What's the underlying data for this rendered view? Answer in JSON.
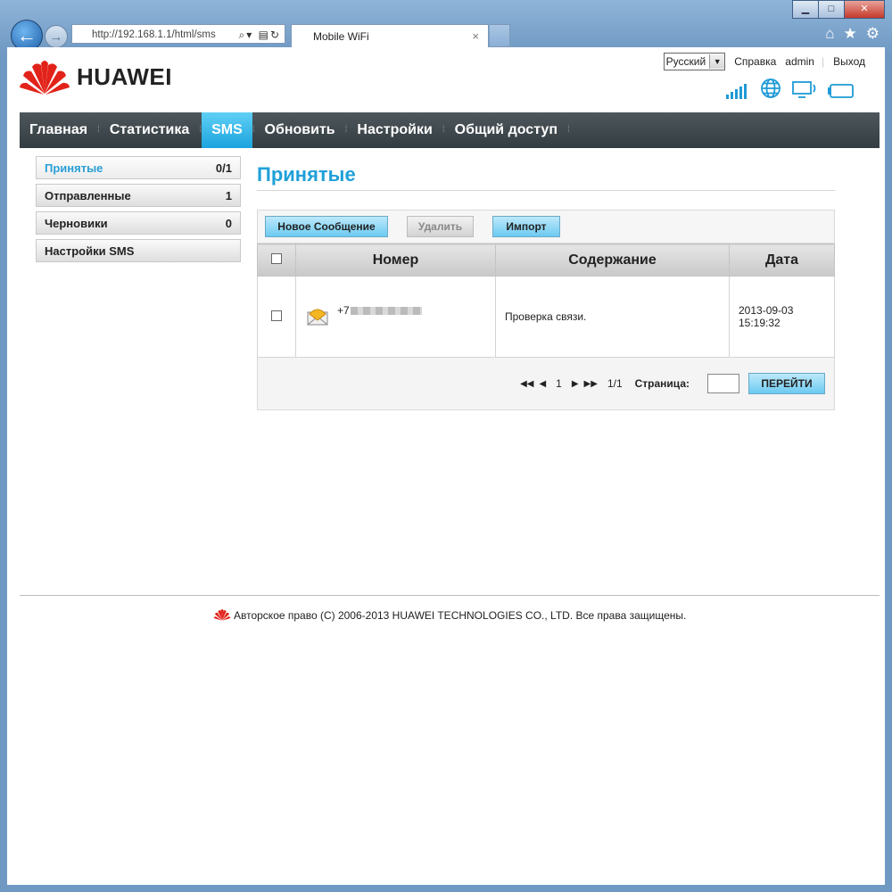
{
  "browser": {
    "address": "http://192.168.1.1/html/sms",
    "tab_title": "Mobile WiFi",
    "tab_close": "×",
    "window_controls": [
      "minimize-icon",
      "maximize-icon",
      "close-icon"
    ],
    "toolbar_icons": [
      "home-icon",
      "favorites-star-icon",
      "gear-icon"
    ]
  },
  "header": {
    "logo_text": "HUAWEI",
    "language": "Русский",
    "help": "Справка",
    "user": "admin",
    "logout": "Выход",
    "status_icons": [
      "signal-strength-icon",
      "internet-globe-icon",
      "connected-device-icon",
      "battery-icon"
    ]
  },
  "nav": {
    "items": [
      "Главная",
      "Статистика",
      "SMS",
      "Обновить",
      "Настройки",
      "Общий доступ"
    ],
    "active": "SMS"
  },
  "sidebar": {
    "items": [
      {
        "label": "Принятые",
        "count": "0/1"
      },
      {
        "label": "Отправленные",
        "count": "1"
      },
      {
        "label": "Черновики",
        "count": "0"
      },
      {
        "label": "Настройки SMS",
        "count": ""
      }
    ]
  },
  "main": {
    "title": "Принятые",
    "buttons": {
      "new_message": "Новое Сообщение",
      "delete": "Удалить",
      "import": "Импорт"
    },
    "columns": [
      "Номер",
      "Содержание",
      "Дата"
    ],
    "rows": [
      {
        "number": "+7",
        "content": "Проверка связи.",
        "date": "2013-09-03 15:19:32"
      }
    ],
    "pager": {
      "current": "1",
      "total": "1/1",
      "page_label": "Страница:",
      "go_button": "ПЕРЕЙТИ"
    }
  },
  "footer": {
    "copyright": "Авторское право (C) 2006-2013 HUAWEI TECHNOLOGIES CO., LTD. Все права защищены."
  },
  "colors": {
    "accent": "#1fa0d9",
    "nav_bg": "#3d464b",
    "brand_red": "#e2231a"
  }
}
